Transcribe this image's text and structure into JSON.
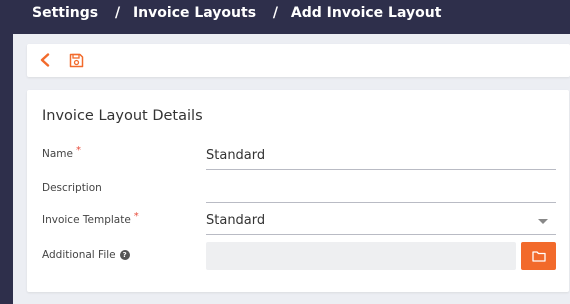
{
  "breadcrumb": {
    "items": [
      "Settings",
      "Invoice Layouts",
      "Add Invoice Layout"
    ],
    "separator": "/"
  },
  "toolbar": {
    "back_icon": "chevron-left-icon",
    "save_icon": "floppy-disk-icon",
    "accent_color": "#f26a2b"
  },
  "form": {
    "title": "Invoice Layout Details",
    "name": {
      "label": "Name",
      "required_mark": "*",
      "value": "Standard"
    },
    "description": {
      "label": "Description",
      "value": ""
    },
    "invoice_template": {
      "label": "Invoice Template",
      "required_mark": "*",
      "value": "Standard"
    },
    "additional_file": {
      "label": "Additional File",
      "help_icon": "question-circle-icon",
      "help_glyph": "?",
      "value": "",
      "button_icon": "folder-icon"
    }
  }
}
